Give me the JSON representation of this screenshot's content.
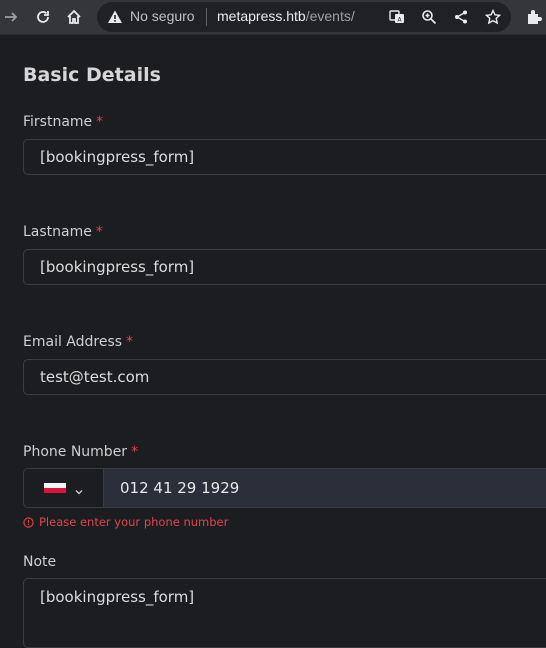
{
  "browser": {
    "security_label": "No seguro",
    "url_host": "metapress.htb",
    "url_path": "/events/"
  },
  "form": {
    "section_title": "Basic Details",
    "required_marker": "*",
    "firstname": {
      "label": "Firstname",
      "value": "[bookingpress_form]"
    },
    "lastname": {
      "label": "Lastname",
      "value": "[bookingpress_form]"
    },
    "email": {
      "label": "Email Address",
      "value": "test@test.com"
    },
    "phone": {
      "label": "Phone Number",
      "value": "012 41 29 1929",
      "error": "Please enter your phone number",
      "country_flag": "poland-flag-icon"
    },
    "note": {
      "label": "Note",
      "value": "[bookingpress_form]"
    }
  },
  "colors": {
    "background": "#1c1d21",
    "required": "#e0434f",
    "error": "#e0434f",
    "border": "#3b3d44"
  }
}
